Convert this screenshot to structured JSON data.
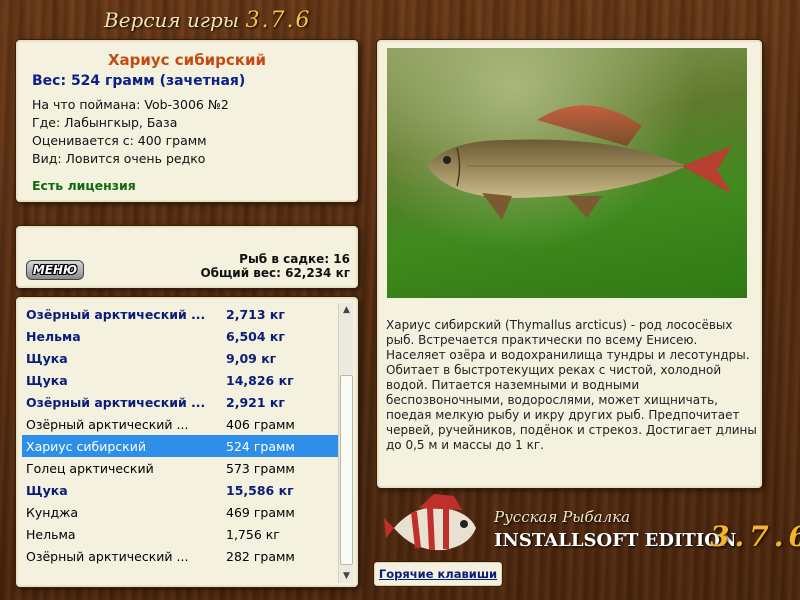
{
  "app": {
    "title_prefix": "Версия игры",
    "version": "3.7.6"
  },
  "fish": {
    "name": "Хариус сибирский",
    "weight": "Вес: 524 грамм (зачетная)",
    "info": [
      "На что поймана: Vob-3006 №2",
      "Где: Лабынгкыр, База",
      "Оценивается с: 400 грамм",
      "Вид: Ловится очень редко"
    ],
    "license": "Есть лицензия",
    "description": "Хариус сибирский (Thymallus arcticus) - род лососёвых рыб. Встречается практически по всему Енисею. Населяет озёра и водохранилища тундры и лесотундры. Обитает в быстротекущих реках с чистой, холодной водой. Питается наземными и водными беспозвоночными, водорослями, может хищничать, поедая мелкую рыбу и икру других рыб. Предпочитает червей, ручейников, подёнок и стрекоз. Достигает длины до 0,5 м и массы до 1 кг."
  },
  "keepnet": {
    "menu_label": "МЕНЮ",
    "count_text": "Рыб в садке: 16",
    "total_text": "Общий вес: 62,234 кг"
  },
  "catch_list": [
    {
      "name": "Озёрный арктический ...",
      "weight": "2,713 кг",
      "style": "big"
    },
    {
      "name": "Нельма",
      "weight": "6,504 кг",
      "style": "big"
    },
    {
      "name": "Щука",
      "weight": "9,09 кг",
      "style": "big"
    },
    {
      "name": "Щука",
      "weight": "14,826 кг",
      "style": "big"
    },
    {
      "name": "Озёрный арктический ...",
      "weight": "2,921 кг",
      "style": "big"
    },
    {
      "name": "Озёрный арктический ...",
      "weight": "406 грамм",
      "style": "normal"
    },
    {
      "name": "Хариус сибирский",
      "weight": "524 грамм",
      "style": "selected"
    },
    {
      "name": "Голец арктический",
      "weight": "573 грамм",
      "style": "normal"
    },
    {
      "name": "Щука",
      "weight": "15,586 кг",
      "style": "big"
    },
    {
      "name": "Кунджа",
      "weight": "469 грамм",
      "style": "normal"
    },
    {
      "name": "Нельма",
      "weight": "1,756 кг",
      "style": "normal"
    },
    {
      "name": "Озёрный арктический ...",
      "weight": "282 грамм",
      "style": "normal"
    }
  ],
  "hotkeys_label": "Горячие клавиши",
  "brand": {
    "line1": "Русская Рыбалка",
    "line2": "INSTALLSOFT EDITION",
    "version": "3.7.6"
  },
  "icons": {
    "scroll_up": "scroll-up-arrow-icon",
    "scroll_down": "scroll-down-arrow-icon",
    "logo": "perch-fish-logo-icon"
  },
  "colors": {
    "accent_orange": "#c44a10",
    "accent_blue": "#0a1d7a",
    "license_green": "#0f6b10",
    "selection": "#2e8fe8",
    "version_gold": "#f3b52a"
  }
}
